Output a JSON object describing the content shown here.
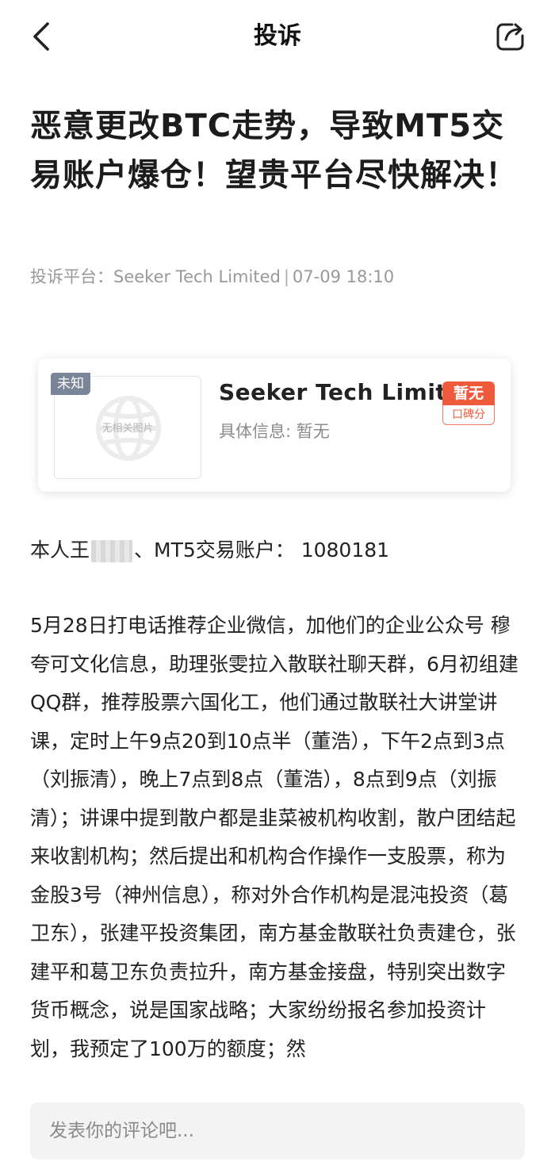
{
  "header": {
    "title": "投诉",
    "back_icon": "chevron-left-icon",
    "share_icon": "share-icon"
  },
  "complaint": {
    "title": "恶意更改BTC走势，导致MT5交易账户爆仓！望贵平台尽快解决！",
    "meta_prefix": "投诉平台：",
    "platform": "Seeker Tech Limited",
    "meta_separator": "|",
    "datetime": "07-09 18:10"
  },
  "card": {
    "tag": "未知",
    "thumb_placeholder": "无相关图片",
    "company_name": "Seeker Tech Limited",
    "info": "具体信息: 暂无",
    "rating_value": "暂无",
    "rating_label": "口碑分",
    "accent_color": "#f05a3c"
  },
  "body": {
    "account_prefix": "本人王",
    "account_suffix": "、MT5交易账户：  1080181",
    "paragraph": "5月28日打电话推荐企业微信，加他们的企业公众号 穆夸可文化信息，助理张雯拉入散联社聊天群，6月初组建QQ群，推荐股票六国化工，他们通过散联社大讲堂讲课，定时上午9点20到10点半（董浩），下午2点到3点（刘振清），晚上7点到8点（董浩），8点到9点（刘振清）；讲课中提到散户都是韭菜被机构收割，散户团结起来收割机构；然后提出和机构合作操作一支股票，称为金股3号（神州信息），称对外合作机构是混沌投资（葛卫东），张建平投资集团，南方基金散联社负责建仓，张建平和葛卫东负责拉升，南方基金接盘，特别突出数字货币概念，说是国家战略；大家纷纷报名参加投资计划，我预定了100万的额度；然"
  },
  "comment": {
    "placeholder": "发表你的评论吧..."
  }
}
